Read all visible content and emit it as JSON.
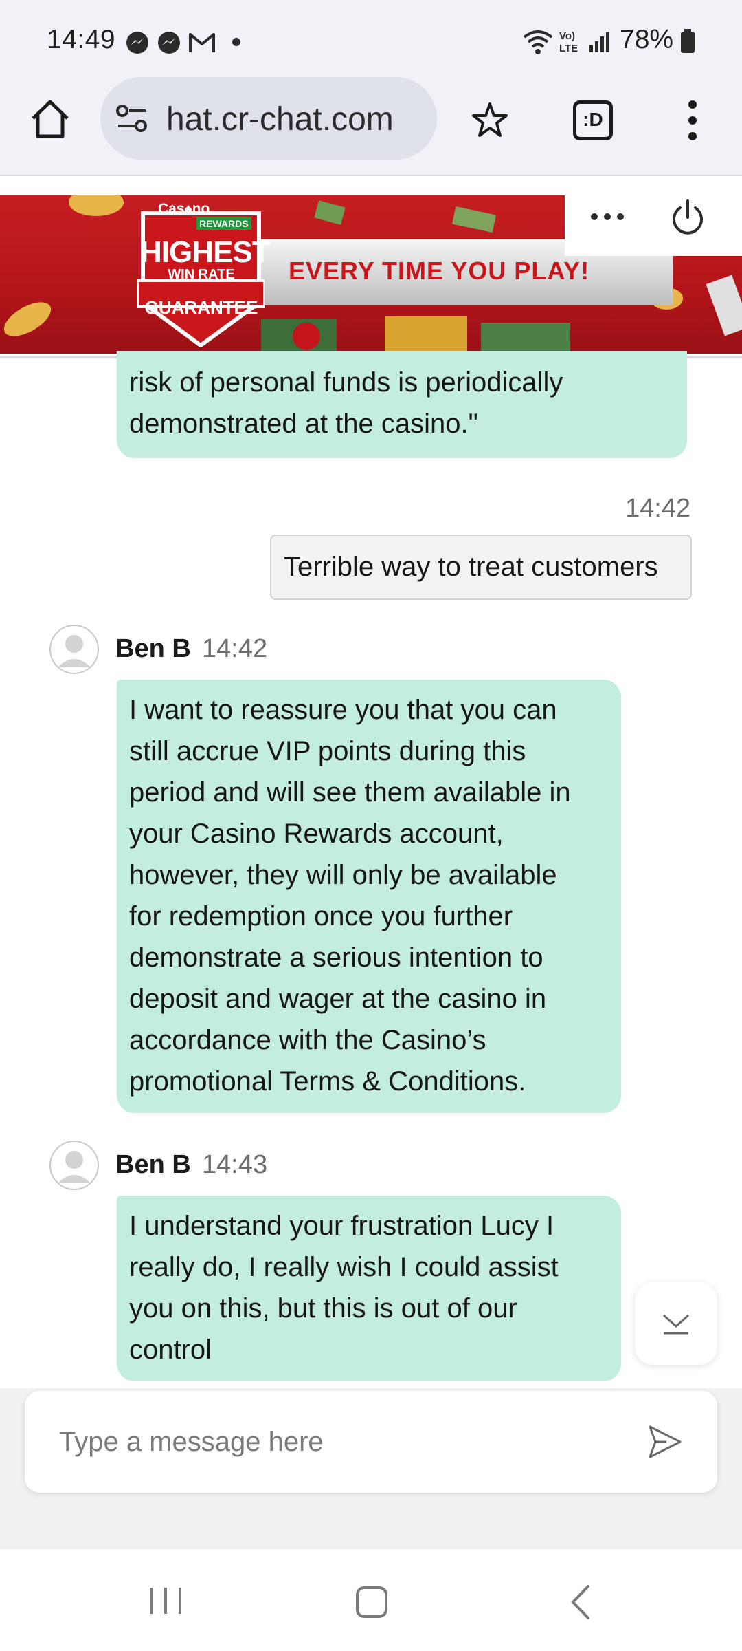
{
  "status_bar": {
    "time": "14:49",
    "battery": "78%",
    "icons": [
      "messenger-icon",
      "messenger-icon",
      "gmail-icon",
      "dot-icon",
      "wifi-icon",
      "volte-icon",
      "signal-icon",
      "battery-icon"
    ]
  },
  "browser": {
    "url": "hat.cr-chat.com",
    "icons": [
      "home-icon",
      "site-settings-icon",
      "bookmark-star-icon",
      "tab-switcher-icon",
      "more-menu-icon"
    ],
    "tab_label": ":D"
  },
  "banner": {
    "badge_top": "Cas♠no",
    "badge_rewards": "REWARDS",
    "badge_highest": "HIGHEST",
    "badge_winrate": "WIN RATE",
    "badge_guarantee": "GUARANTEE",
    "tagline": "EVERY TIME YOU PLAY!"
  },
  "chat": {
    "first_bubble": [
      "risk of personal funds is periodically",
      "demonstrated at the casino.\""
    ],
    "user_message": {
      "time": "14:42",
      "text": "Terrible way to treat customers"
    },
    "agent_message_1": {
      "sender": "Ben B",
      "time": "14:42",
      "lines": [
        "I want to reassure you that you can",
        "still accrue VIP points during this",
        "period and will see them available in",
        "your Casino Rewards account,",
        "however, they will only be available",
        "for redemption once you further",
        "demonstrate a serious intention to",
        "deposit and wager at the casino in",
        "accordance with the Casino’s",
        "promotional Terms & Conditions."
      ]
    },
    "agent_message_2": {
      "sender": "Ben B",
      "time": "14:43",
      "lines": [
        "I understand your frustration Lucy I",
        "really do, I really wish I could assist",
        "you on this, but this is out of our",
        "control"
      ]
    }
  },
  "composer": {
    "placeholder": "Type a message here"
  },
  "colors": {
    "agent_bubble": "#c3edde",
    "user_bubble": "#f2f2f2",
    "banner_red": "#c61e23",
    "chrome_bg": "#f1f2f8"
  }
}
